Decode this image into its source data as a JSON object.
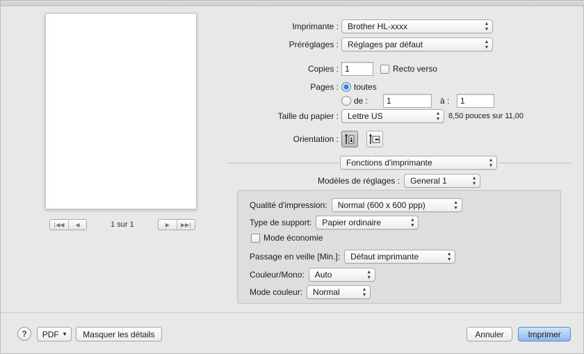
{
  "printer": {
    "label": "Imprimante :",
    "value": "Brother HL-xxxx"
  },
  "presets": {
    "label": "Préréglages :",
    "value": "Réglages par défaut"
  },
  "copies": {
    "label": "Copies :",
    "value": "1",
    "duplex_label": "Recto verso"
  },
  "pages": {
    "label": "Pages :",
    "all_label": "toutes",
    "from_label": "de :",
    "from_value": "1",
    "to_label": "à :",
    "to_value": "1"
  },
  "paper": {
    "label": "Taille du papier :",
    "value": "Lettre US",
    "dimensions": "8,50 pouces sur 11,00"
  },
  "orientation": {
    "label": "Orientation :",
    "portrait_icon": "portrait-orientation-icon",
    "landscape_icon": "landscape-orientation-icon"
  },
  "section": {
    "value": "Fonctions d'imprimante"
  },
  "model_settings": {
    "label": "Modèles de réglages :",
    "value": "General 1"
  },
  "options": {
    "quality": {
      "label": "Qualité d'impression:",
      "value": "Normal (600 x 600 ppp)"
    },
    "media": {
      "label": "Type de support:",
      "value": "Papier ordinaire"
    },
    "economy": {
      "label": "Mode économie"
    },
    "sleep": {
      "label": "Passage en veille [Min.]:",
      "value": "Défaut imprimante"
    },
    "color_mono": {
      "label": "Couleur/Mono:",
      "value": "Auto"
    },
    "color_mode": {
      "label": "Mode couleur:",
      "value": "Normal"
    }
  },
  "pager": {
    "text": "1 sur 1",
    "first": "|◀◀",
    "prev": "◀",
    "next": "▶",
    "last": "▶▶|"
  },
  "footer": {
    "help": "?",
    "pdf": "PDF",
    "pdf_arrow": "▾",
    "hide_details": "Masquer les détails",
    "cancel": "Annuler",
    "print": "Imprimer"
  },
  "chevrons": {
    "up": "▴",
    "down": "▾"
  }
}
